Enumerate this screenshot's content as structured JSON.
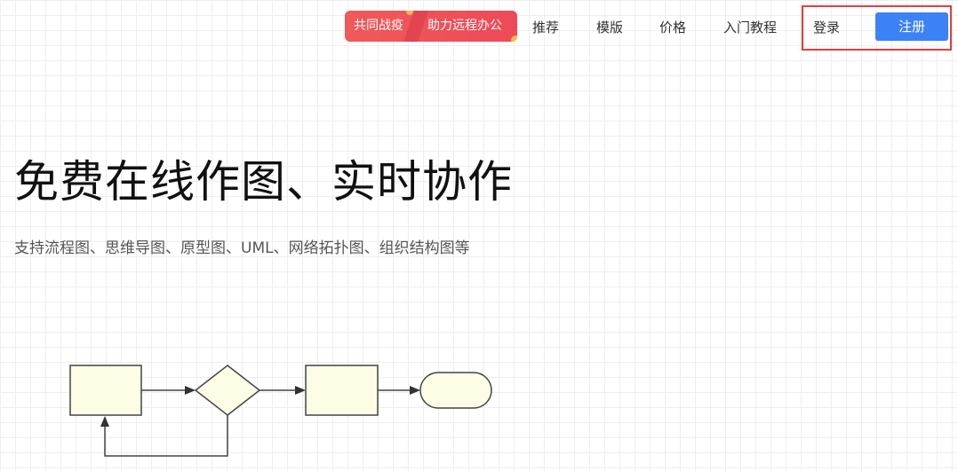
{
  "promo": {
    "left_text": "共同战疫",
    "right_text": "助力远程办公"
  },
  "nav": {
    "recommend": "推荐",
    "templates": "模版",
    "pricing": "价格",
    "tutorial": "入门教程",
    "login": "登录",
    "signup": "注册"
  },
  "hero": {
    "title": "免费在线作图、实时协作",
    "subtitle": "支持流程图、思维导图、原型图、UML、网络拓扑图、组织结构图等"
  },
  "colors": {
    "accent": "#3b82f6",
    "promo": "#ef5a5a",
    "highlight_box": "#e53e3e",
    "node_fill": "#fdfde6"
  }
}
